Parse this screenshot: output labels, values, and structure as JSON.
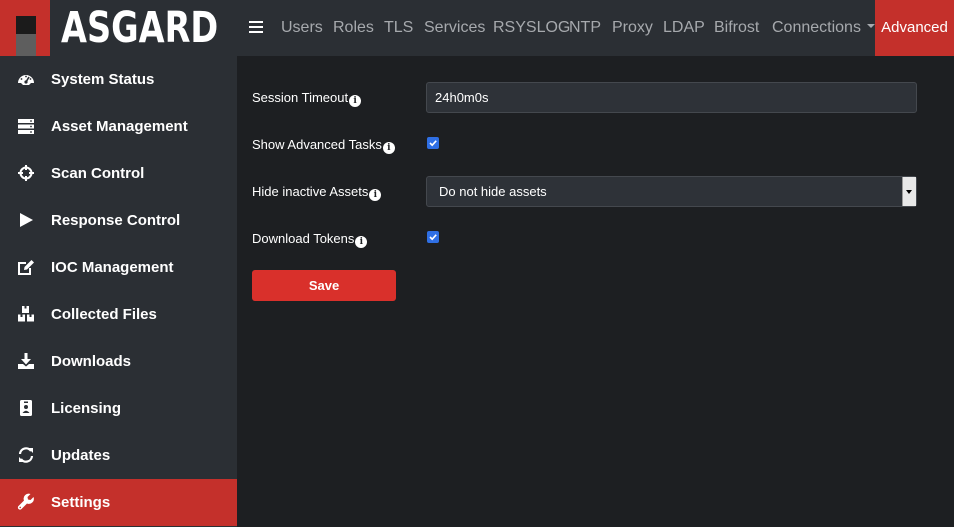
{
  "app": {
    "name": "ASGARD"
  },
  "nav": {
    "items": [
      {
        "label": "Users"
      },
      {
        "label": "Roles"
      },
      {
        "label": "TLS"
      },
      {
        "label": "Services"
      },
      {
        "label": "RSYSLOG"
      },
      {
        "label": "NTP"
      },
      {
        "label": "Proxy"
      },
      {
        "label": "LDAP"
      },
      {
        "label": "Bifrost"
      },
      {
        "label": "Connections"
      }
    ],
    "active": "Advanced"
  },
  "sidebar": {
    "items": [
      {
        "label": "System Status",
        "icon": "dashboard-icon"
      },
      {
        "label": "Asset Management",
        "icon": "server-icon"
      },
      {
        "label": "Scan Control",
        "icon": "crosshair-icon"
      },
      {
        "label": "Response Control",
        "icon": "play-icon"
      },
      {
        "label": "IOC Management",
        "icon": "edit-icon"
      },
      {
        "label": "Collected Files",
        "icon": "boxes-icon"
      },
      {
        "label": "Downloads",
        "icon": "download-icon"
      },
      {
        "label": "Licensing",
        "icon": "id-badge-icon"
      },
      {
        "label": "Updates",
        "icon": "sync-icon"
      },
      {
        "label": "Settings",
        "icon": "wrench-icon",
        "active": true
      }
    ]
  },
  "form": {
    "session_timeout": {
      "label": "Session Timeout",
      "value": "24h0m0s"
    },
    "show_advanced_tasks": {
      "label": "Show Advanced Tasks",
      "checked": true
    },
    "hide_inactive_assets": {
      "label": "Hide inactive Assets",
      "value": "Do not hide assets"
    },
    "download_tokens": {
      "label": "Download Tokens",
      "checked": true
    },
    "save_label": "Save"
  },
  "colors": {
    "accent": "#c4302b",
    "sidebar_bg": "#2b2f34",
    "main_bg": "#1d1f22",
    "checkbox": "#2f6fe4"
  }
}
